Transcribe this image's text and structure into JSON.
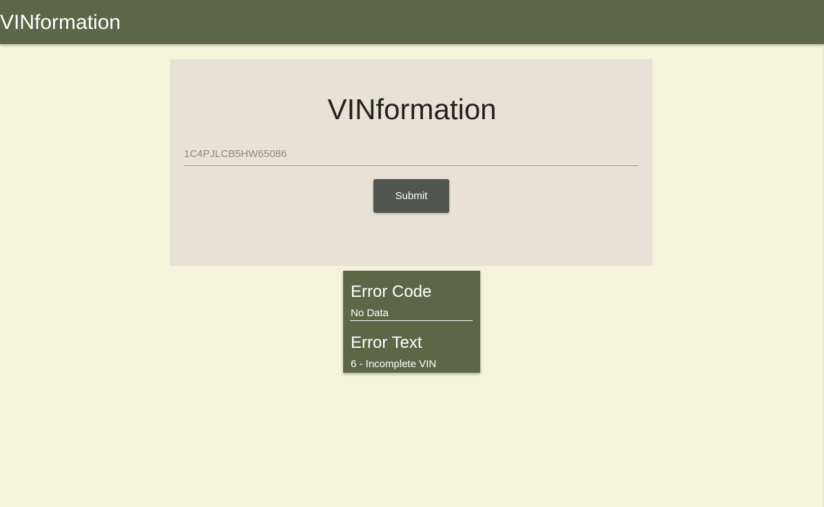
{
  "app_bar": {
    "title": "VINformation"
  },
  "form": {
    "title": "VINformation",
    "vin_input": {
      "value": "",
      "placeholder": "1C4PJLCB5HW65086"
    },
    "submit_label": "Submit"
  },
  "error": {
    "code_heading": "Error Code",
    "code_value": "No Data",
    "text_heading": "Error Text",
    "text_value": "6 - Incomplete VIN"
  },
  "colors": {
    "app_bar_bg": "#5e6648",
    "page_bg": "#f4f4db",
    "card_bg": "#e8e2d6",
    "button_bg": "#525650",
    "error_card_bg": "#5e6648"
  }
}
